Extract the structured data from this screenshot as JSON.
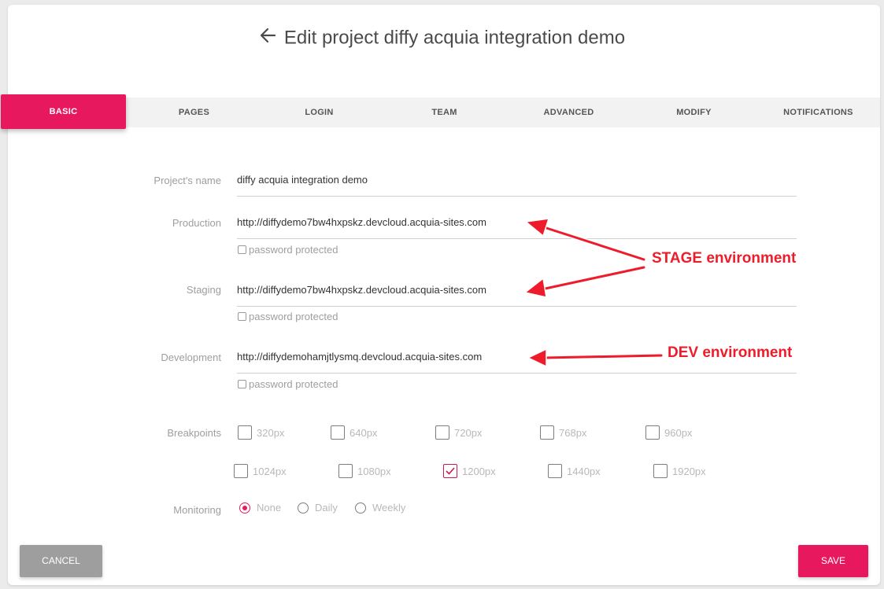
{
  "header": {
    "title": "Edit project diffy acquia integration demo",
    "back_icon": "arrow-left-icon"
  },
  "tabs": [
    {
      "label": "BASIC",
      "active": true
    },
    {
      "label": "PAGES",
      "active": false
    },
    {
      "label": "LOGIN",
      "active": false
    },
    {
      "label": "TEAM",
      "active": false
    },
    {
      "label": "ADVANCED",
      "active": false
    },
    {
      "label": "MODIFY",
      "active": false
    },
    {
      "label": "NOTIFICATIONS",
      "active": false
    }
  ],
  "form": {
    "project_name": {
      "label": "Project's name",
      "value": "diffy acquia integration demo"
    },
    "production": {
      "label": "Production",
      "value": "http://diffydemo7bw4hxpskz.devcloud.acquia-sites.com",
      "password_label": "password protected",
      "password_checked": false
    },
    "staging": {
      "label": "Staging",
      "value": "http://diffydemo7bw4hxpskz.devcloud.acquia-sites.com",
      "password_label": "password protected",
      "password_checked": false
    },
    "development": {
      "label": "Development",
      "value": "http://diffydemohamjtlysmq.devcloud.acquia-sites.com",
      "password_label": "password protected",
      "password_checked": false
    },
    "breakpoints": {
      "label": "Breakpoints",
      "items": [
        {
          "label": "320px",
          "checked": false
        },
        {
          "label": "640px",
          "checked": false
        },
        {
          "label": "720px",
          "checked": false
        },
        {
          "label": "768px",
          "checked": false
        },
        {
          "label": "960px",
          "checked": false
        },
        {
          "label": "1024px",
          "checked": false
        },
        {
          "label": "1080px",
          "checked": false
        },
        {
          "label": "1200px",
          "checked": true
        },
        {
          "label": "1440px",
          "checked": false
        },
        {
          "label": "1920px",
          "checked": false
        }
      ]
    },
    "monitoring": {
      "label": "Monitoring",
      "options": [
        {
          "label": "None",
          "selected": true
        },
        {
          "label": "Daily",
          "selected": false
        },
        {
          "label": "Weekly",
          "selected": false
        }
      ]
    }
  },
  "annotations": {
    "stage": "STAGE environment",
    "dev": "DEV environment",
    "color": "#ee1c2b"
  },
  "buttons": {
    "cancel": "CANCEL",
    "save": "SAVE"
  },
  "colors": {
    "accent": "#e8185f",
    "cancel": "#9e9e9e"
  }
}
